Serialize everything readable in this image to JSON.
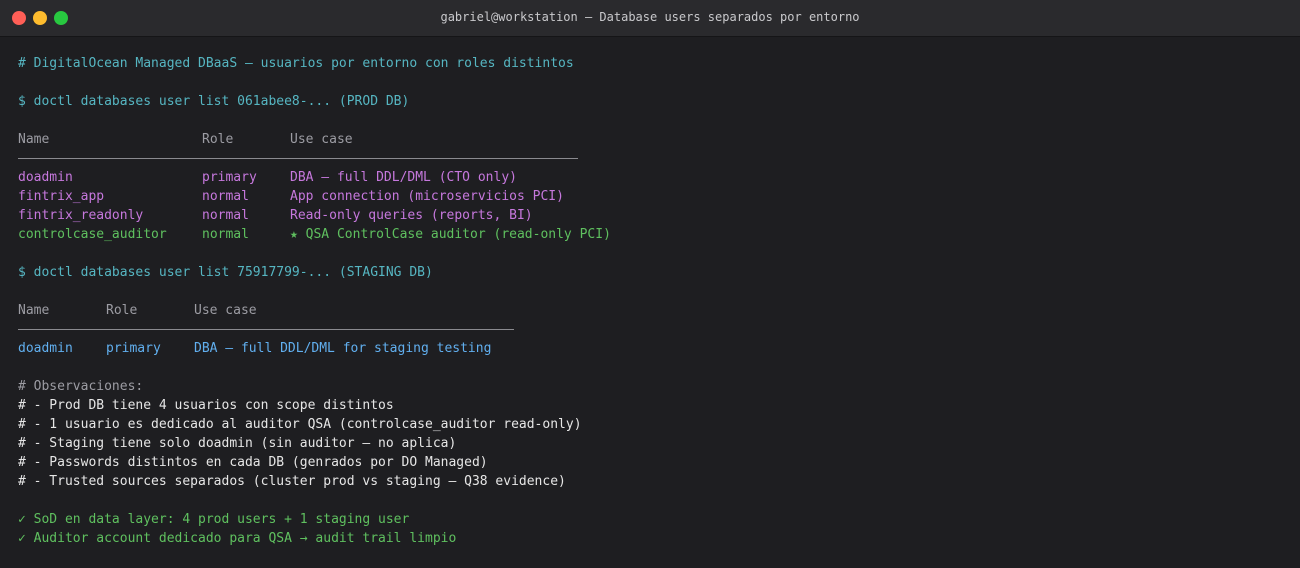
{
  "window": {
    "title": "gabriel@workstation — Database users separados por entorno"
  },
  "comment_header": "# DigitalOcean Managed DBaaS — usuarios por entorno con roles distintos",
  "prod": {
    "command": "$ doctl databases user list 061abee8-... (PROD DB)",
    "headers": [
      "Name",
      "Role",
      "Use case"
    ],
    "rows": [
      {
        "name": "doadmin",
        "role": "primary",
        "use_case": "DBA — full DDL/DML (CTO only)"
      },
      {
        "name": "fintrix_app",
        "role": "normal",
        "use_case": "App connection (microservicios PCI)"
      },
      {
        "name": "fintrix_readonly",
        "role": "normal",
        "use_case": "Read-only queries (reports, BI)"
      },
      {
        "name": "controlcase_auditor",
        "role": "normal",
        "use_case": "★ QSA ControlCase auditor (read-only PCI)"
      }
    ]
  },
  "staging": {
    "command": "$ doctl databases user list 75917799-... (STAGING DB)",
    "headers": [
      "Name",
      "Role",
      "Use case"
    ],
    "rows": [
      {
        "name": "doadmin",
        "role": "primary",
        "use_case": "DBA — full DDL/DML for staging testing"
      }
    ]
  },
  "observations": [
    "# Observaciones:",
    "# - Prod DB tiene 4 usuarios con scope distintos",
    "# - 1 usuario es dedicado al auditor QSA (controlcase_auditor read-only)",
    "# - Staging tiene solo doadmin (sin auditor — no aplica)",
    "# - Passwords distintos en cada DB (genrados por DO Managed)",
    "# - Trusted sources separados (cluster prod vs staging — Q38 evidence)"
  ],
  "results": [
    "✓ SoD en data layer: 4 prod users + 1 staging user",
    "✓ Auditor account dedicado para QSA → audit trail limpio"
  ]
}
